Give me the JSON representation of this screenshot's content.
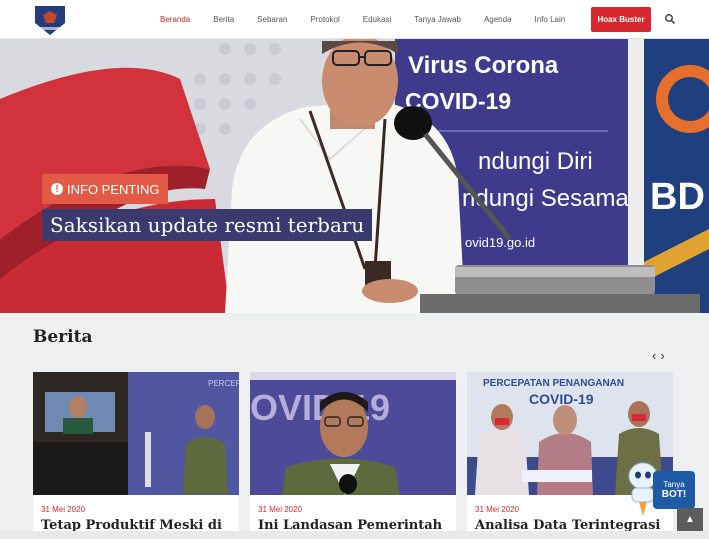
{
  "nav": {
    "items": [
      {
        "label": "Beranda",
        "active": true
      },
      {
        "label": "Berita",
        "active": false
      },
      {
        "label": "Sebaran",
        "active": false
      },
      {
        "label": "Protokol",
        "active": false
      },
      {
        "label": "Edukasi",
        "active": false
      },
      {
        "label": "Tanya Jawab",
        "active": false
      },
      {
        "label": "Agenda",
        "active": false
      },
      {
        "label": "Info Lain",
        "active": false
      }
    ],
    "hoax_label": "Hoax Buster",
    "search_icon": "search-icon"
  },
  "hero": {
    "badge": "INFO PENTING",
    "title": "Saksikan update resmi terbaru",
    "backdrop": {
      "line1": "Virus Corona",
      "line2": "COVID-19",
      "line3": "ndungi Diri",
      "line4": "ndungi Sesama",
      "line5": "ovid19.go.id"
    },
    "accent": "#e25a45",
    "title_bg": "#3b3a6e"
  },
  "berita": {
    "heading": "Berita",
    "prev_label": "‹",
    "next_label": "›",
    "cards": [
      {
        "date": "31 Mei 2020",
        "title": "Tetap Produktif Meski di"
      },
      {
        "date": "31 Mei 2020",
        "title": "Ini Landasan Pemerintah"
      },
      {
        "date": "31 Mei 2020",
        "title": "Analisa Data Terintegrasi"
      }
    ],
    "card3_banner": "PERCEPATAN PENANGANAN",
    "card3_banner2": "COVID-19",
    "card1_banner": "PERCEP"
  },
  "bot": {
    "line1": "Tanya",
    "line2": "BOT!"
  },
  "to_top": "▲",
  "colors": {
    "red": "#d7282f",
    "navy": "#3b3a6e"
  }
}
